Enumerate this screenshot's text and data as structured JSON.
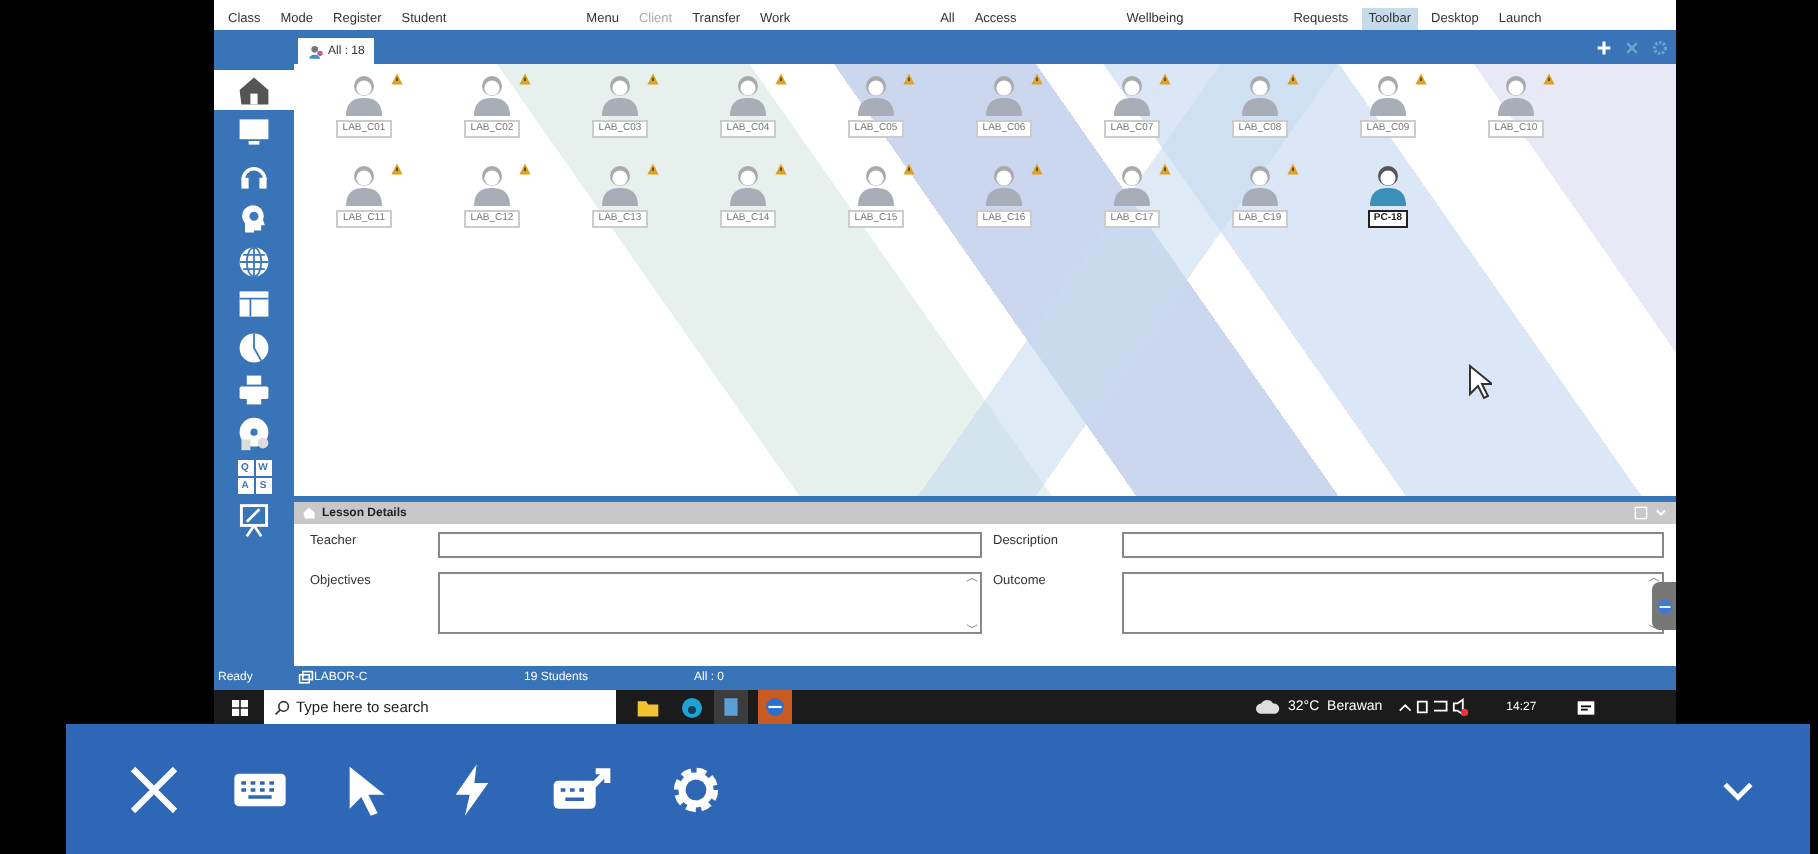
{
  "ribbon": [
    {
      "label": "Class",
      "disabled": false,
      "selected": false
    },
    {
      "label": "Mode",
      "disabled": false,
      "selected": false
    },
    {
      "label": "Register",
      "disabled": false,
      "selected": false
    },
    {
      "label": "Student",
      "disabled": false,
      "selected": false
    },
    {
      "label": "Menu",
      "disabled": false,
      "selected": false
    },
    {
      "label": "Client",
      "disabled": true,
      "selected": false
    },
    {
      "label": "Transfer",
      "disabled": false,
      "selected": false
    },
    {
      "label": "Work",
      "disabled": false,
      "selected": false
    },
    {
      "label": "All",
      "disabled": false,
      "selected": false
    },
    {
      "label": "Access",
      "disabled": false,
      "selected": false
    },
    {
      "label": "Wellbeing",
      "disabled": false,
      "selected": false
    },
    {
      "label": "Requests",
      "disabled": false,
      "selected": false
    },
    {
      "label": "Toolbar",
      "disabled": false,
      "selected": true
    },
    {
      "label": "Desktop",
      "disabled": false,
      "selected": false
    },
    {
      "label": "Launch",
      "disabled": false,
      "selected": false
    }
  ],
  "tab": {
    "label": "All : 18",
    "selected": true
  },
  "sidebar": [
    {
      "kind": "home",
      "selected": true
    },
    {
      "kind": "monitor",
      "selected": false
    },
    {
      "kind": "headphones",
      "selected": false
    },
    {
      "kind": "head",
      "selected": false
    },
    {
      "kind": "globe",
      "selected": false
    },
    {
      "kind": "table",
      "selected": false
    },
    {
      "kind": "pie",
      "selected": false
    },
    {
      "kind": "printer",
      "selected": false
    },
    {
      "kind": "disc",
      "selected": false
    },
    {
      "kind": "keys",
      "selected": false,
      "keys": [
        "Q",
        "W",
        "A",
        "S"
      ]
    },
    {
      "kind": "board",
      "selected": false
    }
  ],
  "students": [
    {
      "name": "LAB_C01",
      "warning": true,
      "online": false,
      "selected": false
    },
    {
      "name": "LAB_C02",
      "warning": true,
      "online": false,
      "selected": false
    },
    {
      "name": "LAB_C03",
      "warning": true,
      "online": false,
      "selected": false
    },
    {
      "name": "LAB_C04",
      "warning": true,
      "online": false,
      "selected": false
    },
    {
      "name": "LAB_C05",
      "warning": true,
      "online": false,
      "selected": false
    },
    {
      "name": "LAB_C06",
      "warning": true,
      "online": false,
      "selected": false
    },
    {
      "name": "LAB_C07",
      "warning": true,
      "online": false,
      "selected": false
    },
    {
      "name": "LAB_C08",
      "warning": true,
      "online": false,
      "selected": false
    },
    {
      "name": "LAB_C09",
      "warning": true,
      "online": false,
      "selected": false
    },
    {
      "name": "LAB_C10",
      "warning": true,
      "online": false,
      "selected": false
    },
    {
      "name": "LAB_C11",
      "warning": true,
      "online": false,
      "selected": false
    },
    {
      "name": "LAB_C12",
      "warning": true,
      "online": false,
      "selected": false
    },
    {
      "name": "LAB_C13",
      "warning": true,
      "online": false,
      "selected": false
    },
    {
      "name": "LAB_C14",
      "warning": true,
      "online": false,
      "selected": false
    },
    {
      "name": "LAB_C15",
      "warning": true,
      "online": false,
      "selected": false
    },
    {
      "name": "LAB_C16",
      "warning": true,
      "online": false,
      "selected": false
    },
    {
      "name": "LAB_C17",
      "warning": true,
      "online": false,
      "selected": false
    },
    {
      "name": "LAB_C19",
      "warning": true,
      "online": false,
      "selected": false
    },
    {
      "name": "PC-18",
      "warning": false,
      "online": true,
      "selected": true
    }
  ],
  "lesson": {
    "title": "Lesson Details",
    "fields": [
      {
        "label": "Teacher",
        "kind": "line"
      },
      {
        "label": "Description",
        "kind": "line"
      },
      {
        "label": "Objectives",
        "kind": "area"
      },
      {
        "label": "Outcome",
        "kind": "area"
      }
    ]
  },
  "status_bar": {
    "state": "Ready",
    "room": "LABOR-C",
    "students": "19 Students",
    "selection": "All : 0"
  },
  "taskbar": {
    "search_placeholder": "Type here to search",
    "weather": "32°C  Berawan",
    "time": "14:27"
  },
  "remote_toolbar": [
    {
      "kind": "close"
    },
    {
      "kind": "keyboard"
    },
    {
      "kind": "pointer"
    },
    {
      "kind": "lightning"
    },
    {
      "kind": "keyboard-send"
    },
    {
      "kind": "settings"
    }
  ]
}
